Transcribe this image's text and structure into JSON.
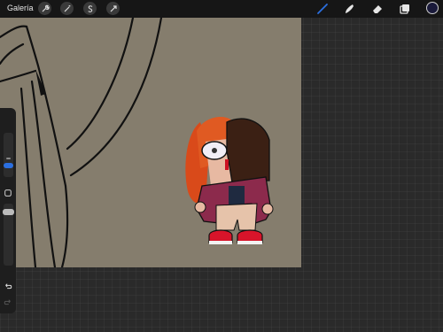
{
  "topbar": {
    "gallery_label": "Galería",
    "left_tools": [
      {
        "name": "wrench-icon"
      },
      {
        "name": "magic-wand-icon"
      },
      {
        "name": "selection-s-icon"
      },
      {
        "name": "transform-arrow-icon"
      }
    ],
    "right_tools": [
      {
        "name": "brush-icon",
        "active": true
      },
      {
        "name": "smudge-icon"
      },
      {
        "name": "eraser-icon"
      },
      {
        "name": "layers-icon"
      }
    ],
    "current_color": "#1a1a3a"
  },
  "colors": {
    "accent": "#2b6fe0",
    "canvas_bg": "#857d6d",
    "workspace_bg": "#2a2a2a",
    "toolbar_bg": "#161616"
  },
  "sidebar": {
    "brush_size_level": 0.72,
    "opacity_level": 0.5,
    "buttons": [
      "modify-square-icon",
      "undo-icon",
      "redo-icon"
    ]
  }
}
